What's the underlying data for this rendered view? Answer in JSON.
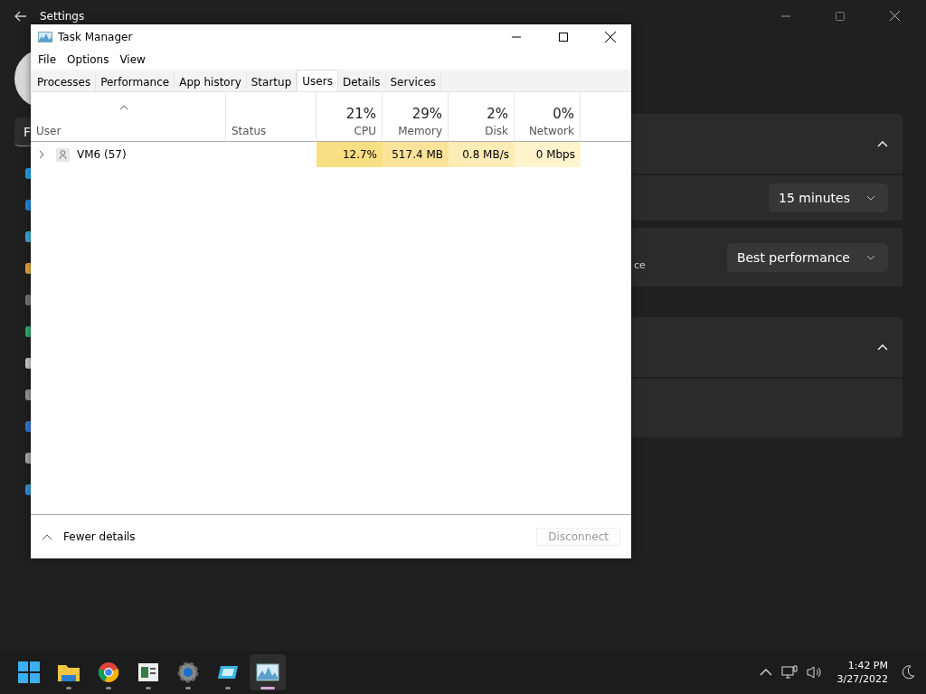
{
  "settings": {
    "title": "Settings",
    "search_text": "F",
    "sections": [
      {
        "expanded": true,
        "rows": [
          {
            "kind": "dropdown",
            "value": "15 minutes"
          },
          {
            "kind": "dropdown",
            "value": "Best performance",
            "description": "ce"
          }
        ]
      },
      {
        "expanded": true,
        "rows": [
          {
            "kind": "blank"
          }
        ]
      }
    ]
  },
  "task_manager": {
    "title": "Task Manager",
    "menu": [
      "File",
      "Options",
      "View"
    ],
    "tabs": [
      {
        "label": "Processes",
        "selected": false
      },
      {
        "label": "Performance",
        "selected": false
      },
      {
        "label": "App history",
        "selected": false
      },
      {
        "label": "Startup",
        "selected": false
      },
      {
        "label": "Users",
        "selected": true
      },
      {
        "label": "Details",
        "selected": false
      },
      {
        "label": "Services",
        "selected": false
      }
    ],
    "columns": [
      {
        "label": "User",
        "sorted": true
      },
      {
        "label": "Status",
        "sorted": false
      },
      {
        "label": "CPU",
        "percent": "21%",
        "sorted": false
      },
      {
        "label": "Memory",
        "percent": "29%",
        "sorted": false
      },
      {
        "label": "Disk",
        "percent": "2%",
        "sorted": false
      },
      {
        "label": "Network",
        "percent": "0%",
        "sorted": false
      }
    ],
    "rows": [
      {
        "user": "VM6 (57)",
        "expanded": false,
        "status": "",
        "metrics": [
          {
            "text": "12.7%",
            "color": "#f9df84"
          },
          {
            "text": "517.4 MB",
            "color": "#fbe39a"
          },
          {
            "text": "0.8 MB/s",
            "color": "#fdecb5"
          },
          {
            "text": "0 Mbps",
            "color": "#fff4cc"
          }
        ]
      }
    ],
    "footer": {
      "toggle": "Fewer details",
      "button": {
        "label": "Disconnect",
        "disabled": true
      }
    }
  },
  "taskbar": {
    "apps": [
      {
        "kind": "start",
        "running": false,
        "active": false
      },
      {
        "kind": "folder",
        "running": true,
        "active": false
      },
      {
        "kind": "browser",
        "running": true,
        "active": false
      },
      {
        "kind": "viewer",
        "running": true,
        "active": false
      },
      {
        "kind": "gear",
        "running": true,
        "active": false
      },
      {
        "kind": "display",
        "running": true,
        "active": false
      },
      {
        "kind": "monitor",
        "running": true,
        "active": true
      }
    ],
    "time": "1:42 PM",
    "date": "3/27/2022"
  }
}
